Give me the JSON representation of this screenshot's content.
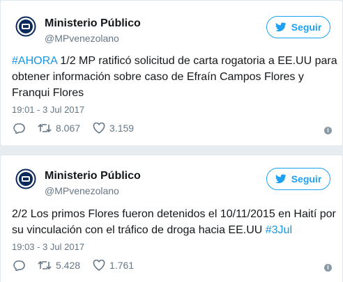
{
  "tweets": [
    {
      "author_name": "Ministerio Público",
      "author_handle": "@MPvenezolano",
      "follow_label": "Seguir",
      "hashtag_prefix": "#AHORA",
      "text": " 1/2 MP ratificó solicitud de carta rogatoria a EE.UU para obtener información sobre caso de Efraín Campos Flores y Franqui Flores",
      "hashtag_suffix": "",
      "timestamp": "19:01 - 3 Jul 2017",
      "retweets": "8.067",
      "likes": "3.159"
    },
    {
      "author_name": "Ministerio Público",
      "author_handle": "@MPvenezolano",
      "follow_label": "Seguir",
      "hashtag_prefix": "",
      "text": "2/2 Los primos Flores fueron detenidos el 10/11/2015 en Haití por su vinculación con el tráfico de droga hacia EE.UU ",
      "hashtag_suffix": "#3Jul",
      "timestamp": "19:03 - 3 Jul 2017",
      "retweets": "5.428",
      "likes": "1.761"
    }
  ],
  "colors": {
    "accent": "#1da1f2",
    "hashtag": "#1b95e0",
    "secondary_text": "#657786"
  },
  "icons": [
    "avatar-seal",
    "bird-icon",
    "reply-icon",
    "retweet-icon",
    "like-icon",
    "info-icon"
  ]
}
